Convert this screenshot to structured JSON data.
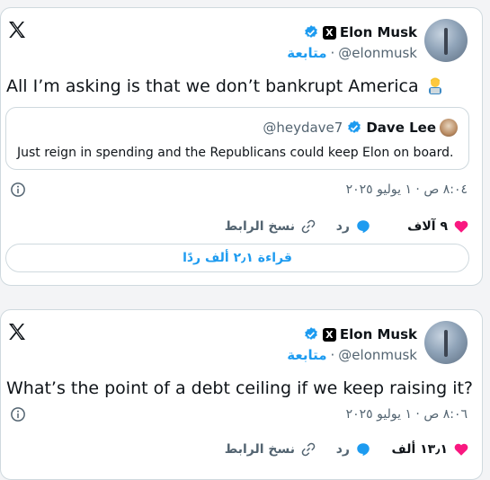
{
  "tweets": [
    {
      "author_name": "Elon Musk",
      "handle": "@elonmusk",
      "follow_label": "متابعة",
      "separator": "·",
      "x_badge": "X",
      "text": "All I’m asking is that we don’t bankrupt America",
      "quote": {
        "author_name": "Dave Lee",
        "handle": "@heydave7",
        "text": "Just reign in spending and the Republicans could keep Elon on board."
      },
      "timestamp": "٨:٠٤ ص · ١ يوليو ٢٠٢٥",
      "likes": "٩ آلاف",
      "reply_label": "رد",
      "copy_link_label": "نسخ الرابط",
      "read_replies_label": "قراءة ٢٫١ ألف ردًا"
    },
    {
      "author_name": "Elon Musk",
      "handle": "@elonmusk",
      "follow_label": "متابعة",
      "separator": "·",
      "x_badge": "X",
      "text": "What’s the point of a debt ceiling if we keep raising it?",
      "timestamp": "٨:٠٦ ص · ١ يوليو ٢٠٢٥",
      "likes": "١٣٫١ ألف",
      "reply_label": "رد",
      "copy_link_label": "نسخ الرابط"
    }
  ],
  "colors": {
    "accent": "#1d9bf0",
    "like": "#f91880",
    "muted": "#536471",
    "text": "#0f1419",
    "border": "#cfd9de"
  },
  "icons": {
    "logo": "x-logo-icon",
    "verified": "verified-badge-icon",
    "info": "info-icon",
    "like": "heart-icon",
    "reply": "speech-bubble-icon",
    "copy_link": "link-icon",
    "emoji": "man-technologist-emoji"
  }
}
